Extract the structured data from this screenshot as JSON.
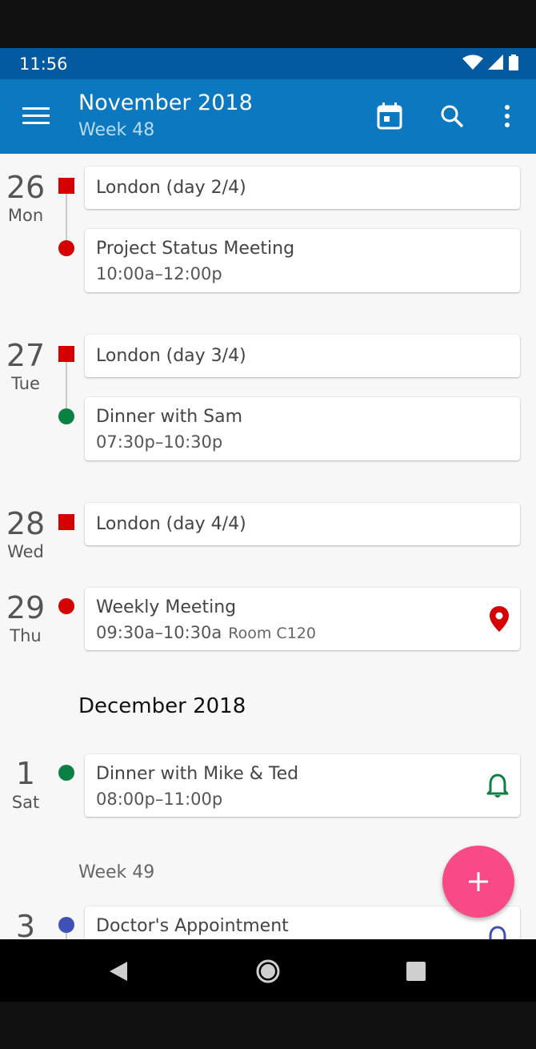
{
  "status": {
    "time": "11:56"
  },
  "appbar": {
    "title": "November 2018",
    "subtitle": "Week 48"
  },
  "colors": {
    "status_bar": "#045aa0",
    "app_bar": "#0b78c0",
    "red": "#d50000",
    "green": "#0b8043",
    "blue": "#3f51b5",
    "fab": "#f74a86"
  },
  "days": [
    {
      "num": "26",
      "name": "Mon"
    },
    {
      "num": "27",
      "name": "Tue"
    },
    {
      "num": "28",
      "name": "Wed"
    },
    {
      "num": "29",
      "name": "Thu"
    },
    {
      "num": "1",
      "name": "Sat"
    },
    {
      "num": "3",
      "name": ""
    }
  ],
  "events": [
    {
      "title": "London (day 2/4)",
      "time": ""
    },
    {
      "title": "Project Status Meeting",
      "time": "10:00a–12:00p"
    },
    {
      "title": "London (day 3/4)",
      "time": ""
    },
    {
      "title": "Dinner with Sam",
      "time": "07:30p–10:30p"
    },
    {
      "title": "London (day 4/4)",
      "time": ""
    },
    {
      "title": "Weekly Meeting",
      "time": "09:30a–10:30a",
      "location": "Room C120",
      "icon": "location-pin-icon"
    },
    {
      "title": "Dinner with Mike & Ted",
      "time": "08:00p–11:00p",
      "icon": "bell-icon"
    },
    {
      "title": "Doctor's Appointment",
      "time": "",
      "icon": "bell-icon"
    }
  ],
  "headers": {
    "month": "December 2018",
    "week": "Week 49"
  }
}
